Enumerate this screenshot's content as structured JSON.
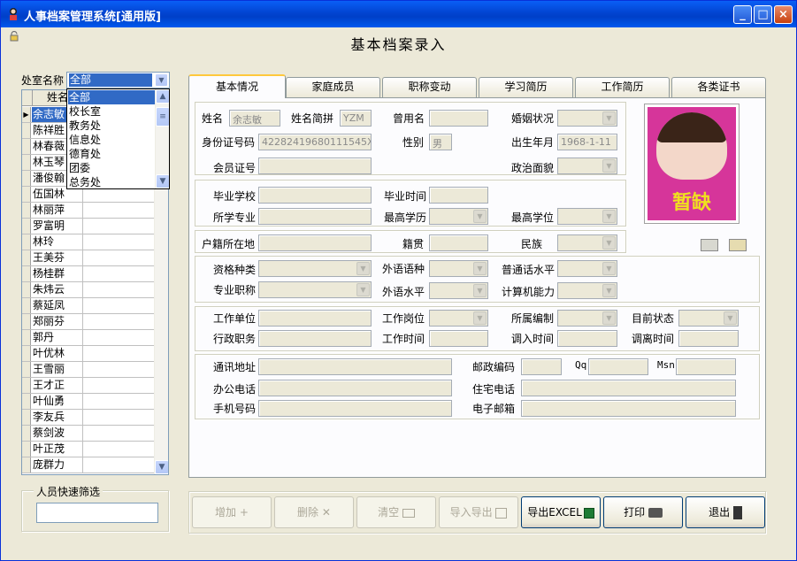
{
  "window": {
    "title": "人事档案管理系统[通用版]",
    "page_title": "基本档案录入",
    "controls": {
      "minimize": "_",
      "maximize": "□",
      "close": "×"
    }
  },
  "left": {
    "dept_label": "处室名称",
    "dept_selected": "全部",
    "column_header": "姓名",
    "dept_options": [
      "全部",
      "校长室",
      "教务处",
      "信息处",
      "德育处",
      "团委",
      "总务处"
    ],
    "names": [
      "余志敏",
      "陈祥胜",
      "林春薇",
      "林玉琴",
      "潘俊翰",
      "伍国林",
      "林丽萍",
      "罗富明",
      "林玲",
      "王美芬",
      "杨桂群",
      "朱炜云",
      "蔡延凤",
      "郑丽芬",
      "郭丹",
      "叶优林",
      "王雪丽",
      "王才正",
      "叶仙勇",
      "李友兵",
      "蔡剑波",
      "叶正茂",
      "庞群力"
    ],
    "filter_label": "人员快速筛选",
    "filter_value": ""
  },
  "tabs": [
    "基本情况",
    "家庭成员",
    "职称变动",
    "学习简历",
    "工作简历",
    "各类证书"
  ],
  "form": {
    "name_label": "姓名",
    "name_value": "余志敏",
    "abbr_label": "姓名简拼",
    "abbr_value": "YZM",
    "former_name_label": "曾用名",
    "former_name_value": "",
    "marital_label": "婚姻状况",
    "marital_value": "",
    "id_label": "身份证号码",
    "id_value": "42282419680111545X",
    "gender_label": "性别",
    "gender_value": "男",
    "birth_label": "出生年月",
    "birth_value": "1968-1-11",
    "member_label": "会员证号",
    "member_value": "",
    "political_label": "政治面貌",
    "political_value": "",
    "school_label": "毕业学校",
    "school_value": "",
    "grad_time_label": "毕业时间",
    "grad_time_value": "",
    "major_label": "所学专业",
    "major_value": "",
    "edu_label": "最高学历",
    "edu_value": "",
    "degree_label": "最高学位",
    "degree_value": "",
    "hukou_label": "户籍所在地",
    "hukou_value": "",
    "native_label": "籍贯",
    "native_value": "",
    "nation_label": "民族",
    "nation_value": "",
    "qual_label": "资格种类",
    "qual_value": "",
    "lang_label": "外语语种",
    "lang_value": "",
    "mandarin_label": "普通话水平",
    "mandarin_value": "",
    "title_label": "专业职称",
    "title_value": "",
    "lang_level_label": "外语水平",
    "lang_level_value": "",
    "computer_label": "计算机能力",
    "computer_value": "",
    "unit_label": "工作单位",
    "unit_value": "",
    "post_label": "工作岗位",
    "post_value": "",
    "staffing_label": "所属编制",
    "staffing_value": "",
    "status_label": "目前状态",
    "status_value": "",
    "admin_label": "行政职务",
    "admin_value": "",
    "work_time_label": "工作时间",
    "work_time_value": "",
    "transfer_in_label": "调入时间",
    "transfer_in_value": "",
    "transfer_out_label": "调离时间",
    "transfer_out_value": "",
    "address_label": "通讯地址",
    "address_value": "",
    "zip_label": "邮政编码",
    "zip_value": "",
    "qq_label": "Qq",
    "qq_value": "",
    "msn_label": "Msn",
    "msn_value": "",
    "office_phone_label": "办公电话",
    "office_phone_value": "",
    "home_phone_label": "住宅电话",
    "home_phone_value": "",
    "mobile_label": "手机号码",
    "mobile_value": "",
    "email_label": "电子邮箱",
    "email_value": ""
  },
  "photo": {
    "placeholder_text": "暂缺",
    "bg_color": "#d6359a"
  },
  "buttons": {
    "add": "增加",
    "add_icon": "+",
    "delete": "删除",
    "delete_icon": "✕",
    "clear": "清空",
    "import_export": "导入导出",
    "export_excel": "导出EXCEL",
    "print": "打印",
    "exit": "退出"
  }
}
